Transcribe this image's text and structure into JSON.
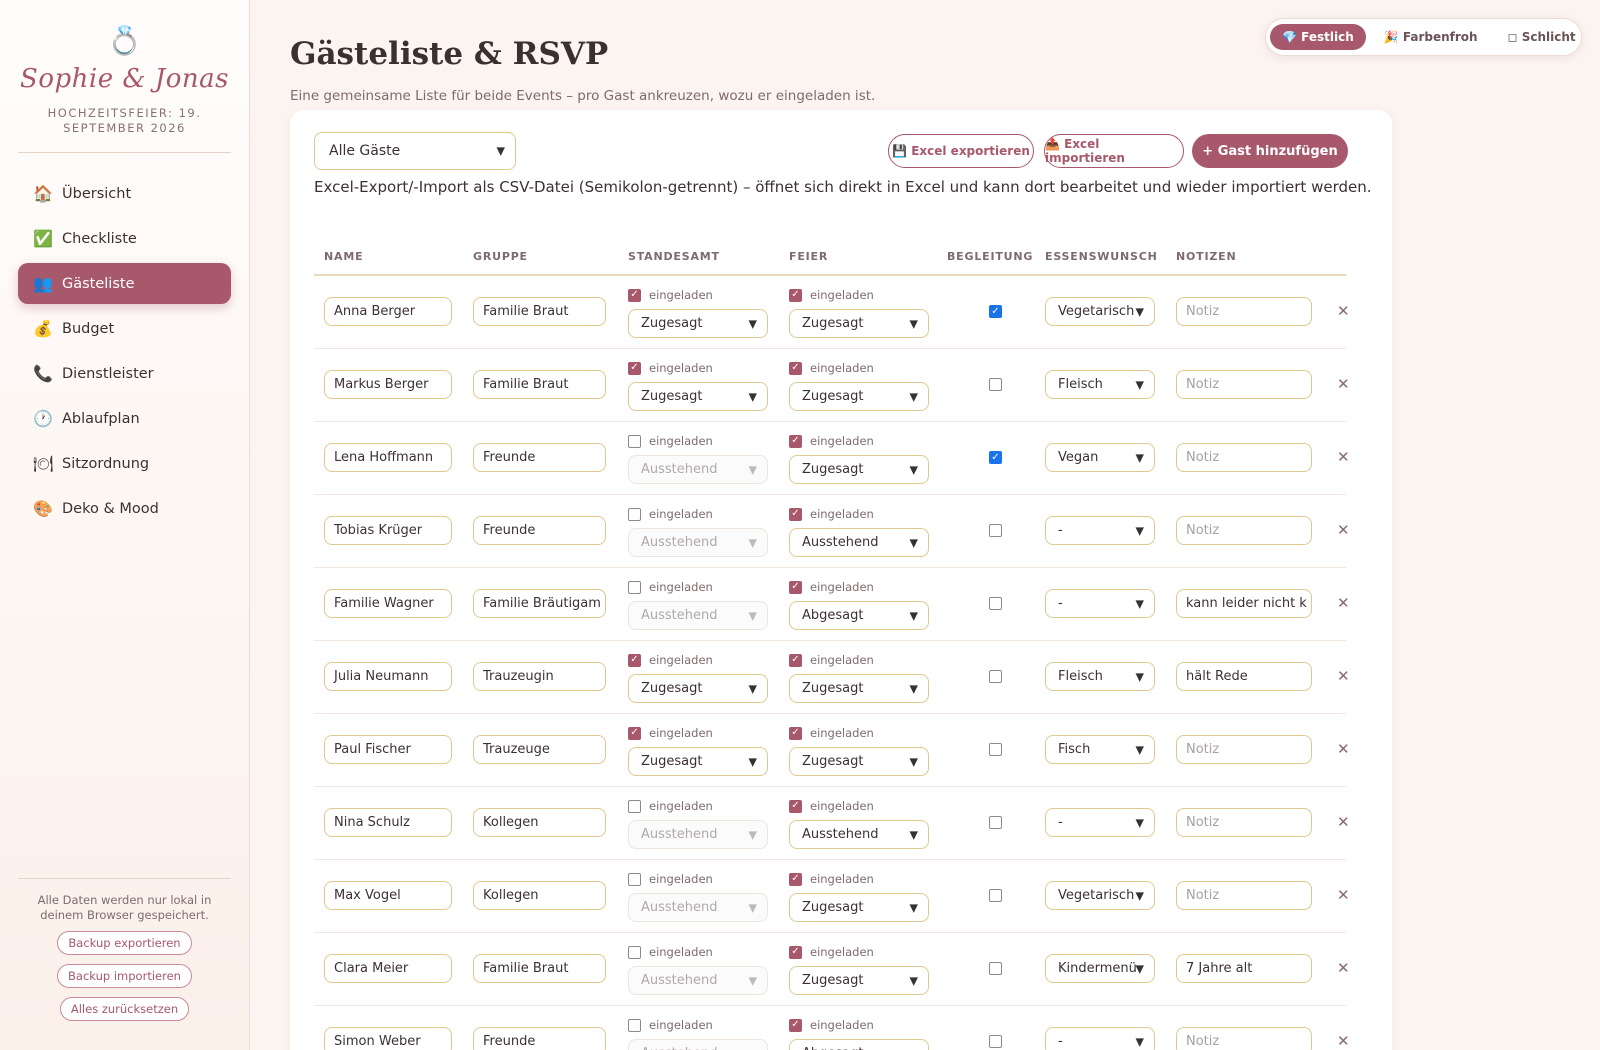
{
  "brand": {
    "icon": "ring-icon",
    "names": "Sophie & Jonas",
    "subtitle": "HOCHZEITSFEIER: 19. SEPTEMBER 2026"
  },
  "nav": [
    {
      "icon": "🏠",
      "icon_name": "house-icon",
      "label": "Übersicht",
      "active": false
    },
    {
      "icon": "✅",
      "icon_name": "check-icon",
      "label": "Checkliste",
      "active": false
    },
    {
      "icon": "👥",
      "icon_name": "people-icon",
      "label": "Gästeliste",
      "active": true
    },
    {
      "icon": "💰",
      "icon_name": "money-bag-icon",
      "label": "Budget",
      "active": false
    },
    {
      "icon": "📞",
      "icon_name": "phone-icon",
      "label": "Dienstleister",
      "active": false
    },
    {
      "icon": "🕐",
      "icon_name": "clock-icon",
      "label": "Ablaufplan",
      "active": false
    },
    {
      "icon": "🍽",
      "icon_name": "dining-icon",
      "label": "Sitzordnung",
      "active": false
    },
    {
      "icon": "🎨",
      "icon_name": "palette-icon",
      "label": "Deko & Mood",
      "active": false
    }
  ],
  "footer": {
    "note": "Alle Daten werden nur lokal in deinem Browser gespeichert.",
    "backup_export": "Backup exportieren",
    "backup_import": "Backup importieren",
    "reset": "Alles zurücksetzen"
  },
  "themes": [
    {
      "label": "💎 Festlich",
      "active": true
    },
    {
      "label": "🎉 Farbenfroh",
      "active": false
    },
    {
      "label": "◻ Schlicht",
      "active": false
    }
  ],
  "page": {
    "title": "Gästeliste & RSVP",
    "subtitle": "Eine gemeinsame Liste für beide Events – pro Gast ankreuzen, wozu er eingeladen ist."
  },
  "toolbar": {
    "filter": "Alle Gäste",
    "export_label": "💾 Excel exportieren",
    "import_label": "📤 Excel importieren",
    "add_label": "+ Gast hinzufügen",
    "csv_note": "Excel-Export/-Import als CSV-Datei (Semikolon-getrennt) – öffnet sich direkt in Excel und kann dort bearbeitet und wieder importiert werden."
  },
  "columns": {
    "name": "NAME",
    "group": "GRUPPE",
    "civil": "STANDESAMT",
    "party": "FEIER",
    "companion": "BEGLEITUNG",
    "meal": "ESSENSWUNSCH",
    "notes": "NOTIZEN"
  },
  "invited_label": "eingeladen",
  "notes_placeholder": "Notiz",
  "colors": {
    "accent": "#a8586b",
    "border": "#e0c98e",
    "background": "#fbf4f0"
  },
  "guests": [
    {
      "name": "Anna Berger",
      "group": "Familie Braut",
      "civil_invited": true,
      "civil_status": "Zugesagt",
      "party_invited": true,
      "party_status": "Zugesagt",
      "companion": true,
      "meal": "Vegetarisch",
      "notes": ""
    },
    {
      "name": "Markus Berger",
      "group": "Familie Braut",
      "civil_invited": true,
      "civil_status": "Zugesagt",
      "party_invited": true,
      "party_status": "Zugesagt",
      "companion": false,
      "meal": "Fleisch",
      "notes": ""
    },
    {
      "name": "Lena Hoffmann",
      "group": "Freunde",
      "civil_invited": false,
      "civil_status": "Ausstehend",
      "party_invited": true,
      "party_status": "Zugesagt",
      "companion": true,
      "meal": "Vegan",
      "notes": ""
    },
    {
      "name": "Tobias Krüger",
      "group": "Freunde",
      "civil_invited": false,
      "civil_status": "Ausstehend",
      "party_invited": true,
      "party_status": "Ausstehend",
      "companion": false,
      "meal": "-",
      "notes": ""
    },
    {
      "name": "Familie Wagner",
      "group": "Familie Bräutigam",
      "civil_invited": false,
      "civil_status": "Ausstehend",
      "party_invited": true,
      "party_status": "Abgesagt",
      "companion": false,
      "meal": "-",
      "notes": "kann leider nicht k"
    },
    {
      "name": "Julia Neumann",
      "group": "Trauzeugin",
      "civil_invited": true,
      "civil_status": "Zugesagt",
      "party_invited": true,
      "party_status": "Zugesagt",
      "companion": false,
      "meal": "Fleisch",
      "notes": "hält Rede"
    },
    {
      "name": "Paul Fischer",
      "group": "Trauzeuge",
      "civil_invited": true,
      "civil_status": "Zugesagt",
      "party_invited": true,
      "party_status": "Zugesagt",
      "companion": false,
      "meal": "Fisch",
      "notes": ""
    },
    {
      "name": "Nina Schulz",
      "group": "Kollegen",
      "civil_invited": false,
      "civil_status": "Ausstehend",
      "party_invited": true,
      "party_status": "Ausstehend",
      "companion": false,
      "meal": "-",
      "notes": ""
    },
    {
      "name": "Max Vogel",
      "group": "Kollegen",
      "civil_invited": false,
      "civil_status": "Ausstehend",
      "party_invited": true,
      "party_status": "Zugesagt",
      "companion": false,
      "meal": "Vegetarisch",
      "notes": ""
    },
    {
      "name": "Clara Meier",
      "group": "Familie Braut",
      "civil_invited": false,
      "civil_status": "Ausstehend",
      "party_invited": true,
      "party_status": "Zugesagt",
      "companion": false,
      "meal": "Kindermenü",
      "notes": "7 Jahre alt"
    },
    {
      "name": "Simon Weber",
      "group": "Freunde",
      "civil_invited": false,
      "civil_status": "Ausstehend",
      "party_invited": true,
      "party_status": "Abgesagt",
      "companion": false,
      "meal": "-",
      "notes": ""
    }
  ]
}
